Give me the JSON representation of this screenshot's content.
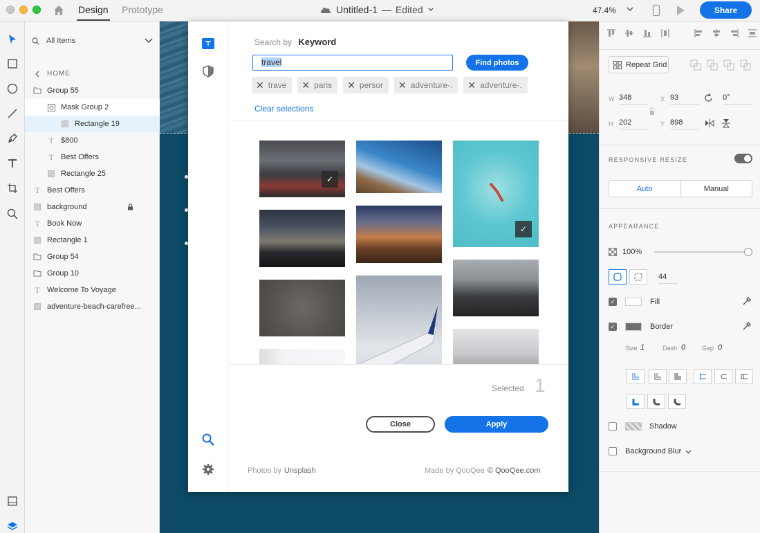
{
  "titlebar": {
    "tab_design": "Design",
    "tab_prototype": "Prototype",
    "doc_name": "Untitled-1",
    "doc_sep": "—",
    "doc_status": "Edited",
    "zoom": "47.4%",
    "share": "Share"
  },
  "layers": {
    "filter": "All Items",
    "breadcrumb": "HOME",
    "items": [
      {
        "label": "Group 55",
        "icon": "folder-icon"
      },
      {
        "label": "Mask Group 2",
        "icon": "mask-icon"
      },
      {
        "label": "Rectangle 19",
        "icon": "rectangle-icon"
      },
      {
        "label": "$800",
        "icon": "text-icon"
      },
      {
        "label": "Best Offers",
        "icon": "text-icon"
      },
      {
        "label": "Rectangle 25",
        "icon": "rectangle-icon"
      },
      {
        "label": "Best Offers",
        "icon": "text-icon"
      },
      {
        "label": "background",
        "icon": "rectangle-icon"
      },
      {
        "label": "Book Now",
        "icon": "text-icon"
      },
      {
        "label": "Rectangle 1",
        "icon": "rectangle-icon"
      },
      {
        "label": "Group 54",
        "icon": "folder-icon"
      },
      {
        "label": "Group 10",
        "icon": "folder-icon"
      },
      {
        "label": "Welcome To Voyage",
        "icon": "text-icon"
      },
      {
        "label": "adventure-beach-carefree...",
        "icon": "rectangle-icon"
      }
    ]
  },
  "dialog": {
    "search_by": "Search by",
    "search_mode": "Keyword",
    "keyword": "travel",
    "find_button": "Find photos",
    "chips": [
      "trave",
      "paris",
      "persor",
      "adventure-.",
      "adventure-."
    ],
    "clear": "Clear selections",
    "selected_label": "Selected",
    "selected_count": "1",
    "close": "Close",
    "apply": "Apply",
    "photos_by": "Photos by",
    "photos_source": "Unsplash",
    "made_by": "Made by QooQee",
    "copyright": "© QooQee.com"
  },
  "props": {
    "repeat_grid": "Repeat Grid",
    "w_label": "W",
    "w": "348",
    "x_label": "X",
    "x": "93",
    "h_label": "H",
    "h": "202",
    "y_label": "Y",
    "y": "898",
    "rotation": "0°",
    "responsive_resize": "RESPONSIVE RESIZE",
    "auto": "Auto",
    "manual": "Manual",
    "appearance": "APPEARANCE",
    "opacity": "100%",
    "corner_radius": "44",
    "fill": "Fill",
    "border": "Border",
    "size_label": "Size",
    "size": "1",
    "dash_label": "Dash",
    "dash": "0",
    "gap_label": "Gap",
    "gap": "0",
    "shadow": "Shadow",
    "background_blur": "Background Blur"
  },
  "colors": {
    "accent": "#1473e6",
    "canvas": "#0c4a66"
  }
}
